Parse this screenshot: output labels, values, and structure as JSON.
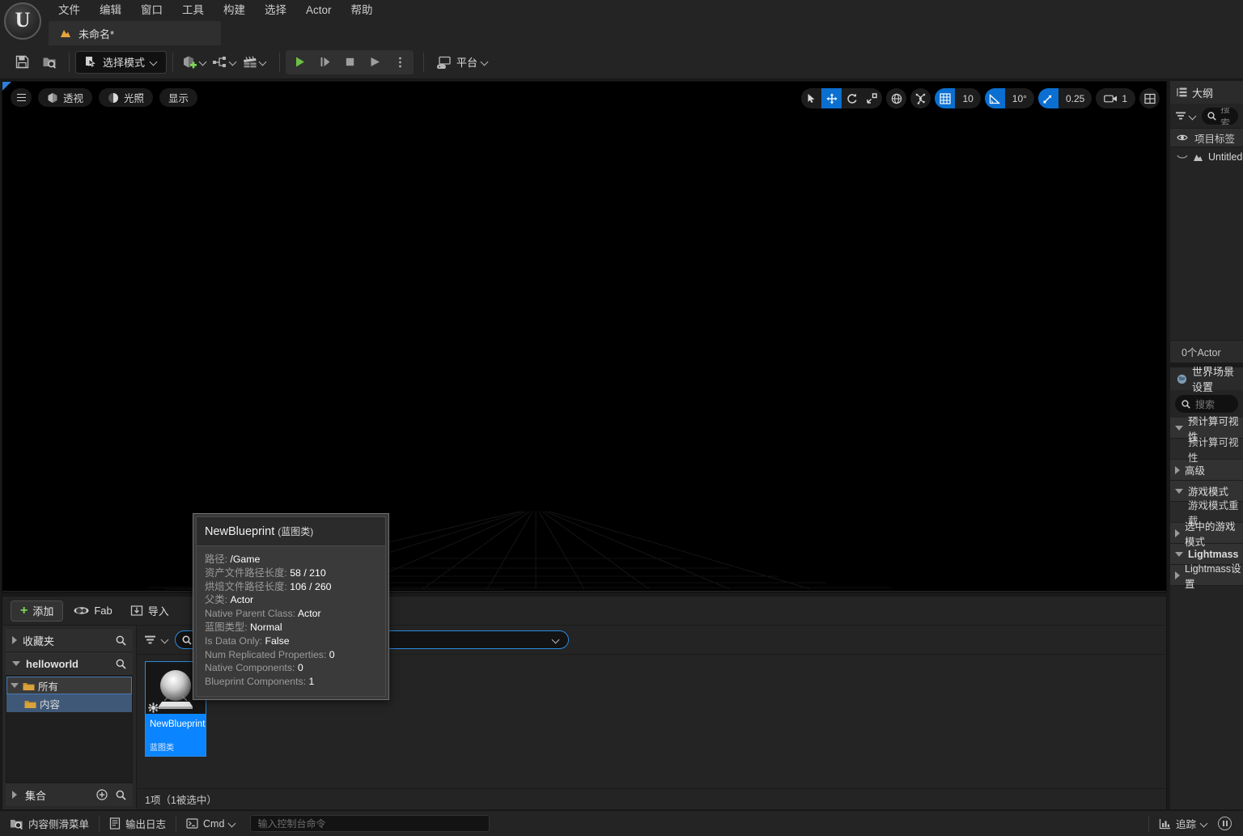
{
  "app": {
    "logo_letter": "U",
    "menu": [
      "文件",
      "编辑",
      "窗口",
      "工具",
      "构建",
      "选择",
      "Actor",
      "帮助"
    ],
    "tab": {
      "label": "未命名*",
      "icon": "level-icon"
    }
  },
  "toolbar": {
    "save_icon": "save-icon",
    "browse_icon": "browse-content-icon",
    "mode_label": "选择模式",
    "mode_icon": "select-mode-icon",
    "create_icon": "add-actor-icon",
    "blueprint_icon": "blueprints-icon",
    "cinematics_icon": "cinematics-icon",
    "play_icon": "play-icon",
    "skip_icon": "step-icon",
    "stop_icon": "stop-icon",
    "eject_icon": "eject-icon",
    "more_icon": "more-options-icon",
    "platform_label": "平台",
    "platform_icon": "platform-icon"
  },
  "viewport": {
    "menu_icon": "viewport-menu-icon",
    "left_buttons": [
      {
        "label": "透视",
        "icon": "perspective-icon"
      },
      {
        "label": "光照",
        "icon": "lit-icon"
      },
      {
        "label": "显示",
        "icon": "show-icon"
      }
    ],
    "transform_tools": [
      {
        "icon": "select-arrow-icon",
        "active": false
      },
      {
        "icon": "move-tool-icon",
        "active": true
      },
      {
        "icon": "rotate-tool-icon",
        "active": false
      },
      {
        "icon": "scale-tool-icon",
        "active": false
      }
    ],
    "coord_icon": "world-coordinate-icon",
    "pivot_icon": "pivot-icon",
    "grid_snap": {
      "icon": "grid-snap-icon",
      "value": "10",
      "active": true
    },
    "angle_snap": {
      "icon": "angle-snap-icon",
      "value": "10°",
      "active": true
    },
    "scale_snap": {
      "icon": "scale-snap-icon",
      "value": "0.25",
      "active": true
    },
    "camera_speed": {
      "icon": "camera-icon",
      "value": "1"
    },
    "layout_icon": "viewport-layout-icon"
  },
  "outliner": {
    "title": "大纲",
    "title_icon": "outliner-icon",
    "filter_icon": "filter-icon",
    "search_placeholder": "搜索",
    "search_icon": "search-icon",
    "column_header": "项目标签",
    "eye_icon": "eye-icon",
    "rows": [
      {
        "label": "Untitled",
        "icon": "level-icon",
        "visibility_icon": "eye-closed-icon"
      }
    ],
    "footer": "0个Actor"
  },
  "world_settings": {
    "title": "世界场景设置",
    "title_icon": "world-icon",
    "search_placeholder": "搜索",
    "search_icon": "search-icon",
    "rows": [
      {
        "label": "预计算可视性",
        "type": "category",
        "expanded": true,
        "bold": false
      },
      {
        "label": "预计算可视性",
        "type": "property"
      },
      {
        "label": "高级",
        "type": "category",
        "expanded": false,
        "bold": false
      },
      {
        "label": "游戏模式",
        "type": "category",
        "expanded": true,
        "bold": false
      },
      {
        "label": "游戏模式重载",
        "type": "property"
      },
      {
        "label": "选中的游戏模式",
        "type": "category",
        "expanded": false,
        "bold": false
      },
      {
        "label": "Lightmass",
        "type": "category",
        "expanded": true,
        "bold": true
      },
      {
        "label": "Lightmass设置",
        "type": "category",
        "expanded": false,
        "bold": false
      }
    ]
  },
  "content_browser": {
    "add_label": "添加",
    "add_icon": "plus-icon",
    "fab_label": "Fab",
    "fab_icon": "fab-icon",
    "import_label": "导入",
    "import_icon": "import-icon",
    "tree": {
      "favorites": {
        "label": "收藏夹",
        "search_icon": "search-icon",
        "expanded": false
      },
      "project": {
        "label": "helloworld",
        "search_icon": "search-icon",
        "expanded": true
      },
      "nodes": [
        {
          "label": "所有",
          "depth": 0,
          "expanded": true,
          "selected_outline": true
        },
        {
          "label": "内容",
          "depth": 1,
          "expanded": false,
          "selected": true
        }
      ],
      "collections": {
        "label": "集合",
        "add_icon": "plus-circle-icon",
        "search_icon": "search-icon",
        "expanded": false
      }
    },
    "filter_icon": "filter-icon",
    "search_placeholder": "",
    "search_icon": "search-icon",
    "path_dropdown_icon": "chevron-down-icon",
    "assets": [
      {
        "name": "NewBlueprint",
        "type": "蓝图类",
        "selected": true,
        "badge_icon": "blueprint-badge-icon"
      }
    ],
    "status": "1项（1被选中）"
  },
  "tooltip": {
    "title": "NewBlueprint",
    "subtitle": "(蓝图类)",
    "rows": [
      {
        "key": "路径:",
        "value": "/Game"
      },
      {
        "key": "资产文件路径长度:",
        "value": "58 / 210"
      },
      {
        "key": "烘焙文件路径长度:",
        "value": "106 / 260"
      },
      {
        "key": "父类:",
        "value": "Actor"
      },
      {
        "key": "Native Parent Class:",
        "value": "Actor"
      },
      {
        "key": "蓝图类型:",
        "value": "Normal"
      },
      {
        "key": "Is Data Only:",
        "value": "False"
      },
      {
        "key": "Num Replicated Properties:",
        "value": "0"
      },
      {
        "key": "Native Components:",
        "value": "0"
      },
      {
        "key": "Blueprint Components:",
        "value": "1"
      }
    ]
  },
  "statusbar": {
    "content_drawer": {
      "label": "内容侧滑菜单",
      "icon": "content-drawer-icon"
    },
    "output_log": {
      "label": "输出日志",
      "icon": "output-log-icon"
    },
    "cmd": {
      "label": "Cmd",
      "icon": "cmd-icon"
    },
    "console_placeholder": "输入控制台命令",
    "trace": {
      "label": "追踪",
      "icon": "trace-icon"
    },
    "status_icon": "status-indicator-icon"
  },
  "colors": {
    "accent_blue": "#0a84ff",
    "toolbar_blue": "#0a6fd0",
    "green": "#7ed957",
    "panel_bg": "#242424",
    "viewport_bg": "#000000"
  }
}
